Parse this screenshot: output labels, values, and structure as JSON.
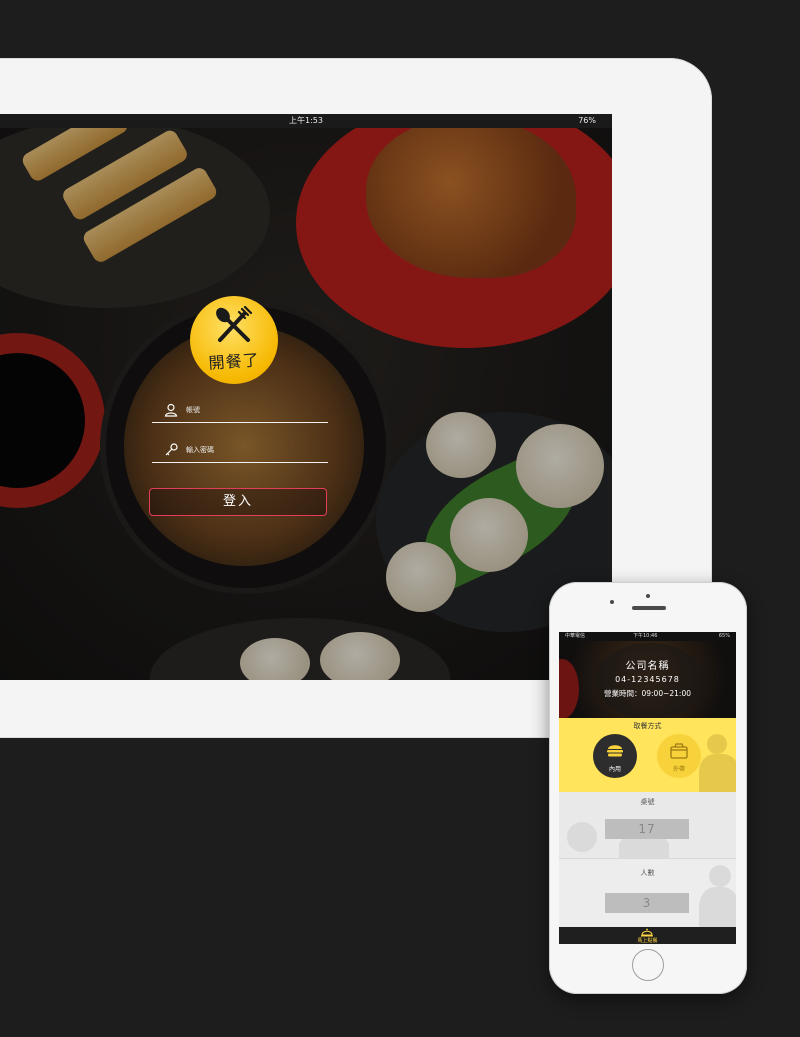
{
  "tablet": {
    "status_time": "上午1:53",
    "status_battery": "76%",
    "logo_text": "開餐了",
    "account_placeholder": "帳號",
    "password_placeholder": "輸入密碼",
    "login_label": "登入"
  },
  "phone": {
    "status_carrier": "中華電信",
    "status_time": "下午10:46",
    "status_battery": "65%",
    "company_name": "公司名稱",
    "phone_number": "04-12345678",
    "business_hours": "營業時間：09:00~21:00",
    "pickup_title": "取餐方式",
    "dine_in_label": "內用",
    "takeout_label": "外帶",
    "table_label": "桌號",
    "table_value": "17",
    "people_label": "人數",
    "people_value": "3",
    "bottom_label": "馬上點餐"
  },
  "colors": {
    "background": "#1d1d1d",
    "login_border": "#e33d5a",
    "accent_yellow": "#ffe45c",
    "logo_yellow": "#f6b800"
  }
}
